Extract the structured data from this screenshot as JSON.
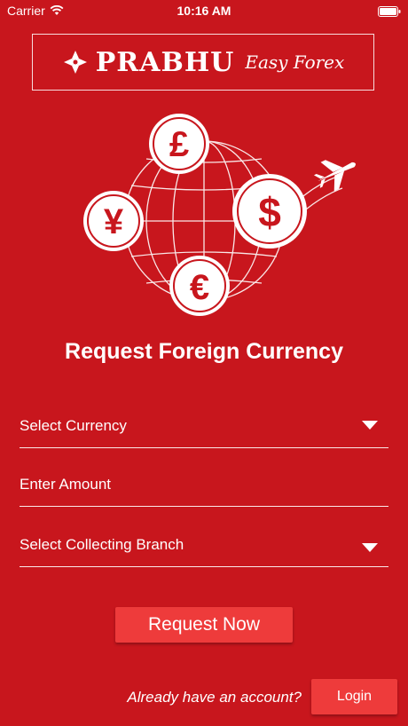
{
  "status_bar": {
    "carrier": "Carrier",
    "time": "10:16 AM"
  },
  "logo": {
    "brand": "PRABHU",
    "subtitle": "Easy Forex"
  },
  "hero": {
    "symbols": {
      "pound": "£",
      "yen": "¥",
      "dollar": "$",
      "euro": "€"
    }
  },
  "headline": "Request Foreign Currency",
  "form": {
    "currency_label": "Select Currency",
    "amount_label": "Enter Amount",
    "branch_label": "Select Collecting Branch"
  },
  "request_button": "Request Now",
  "footer": {
    "prompt": "Already have an account?",
    "login_button": "Login"
  }
}
